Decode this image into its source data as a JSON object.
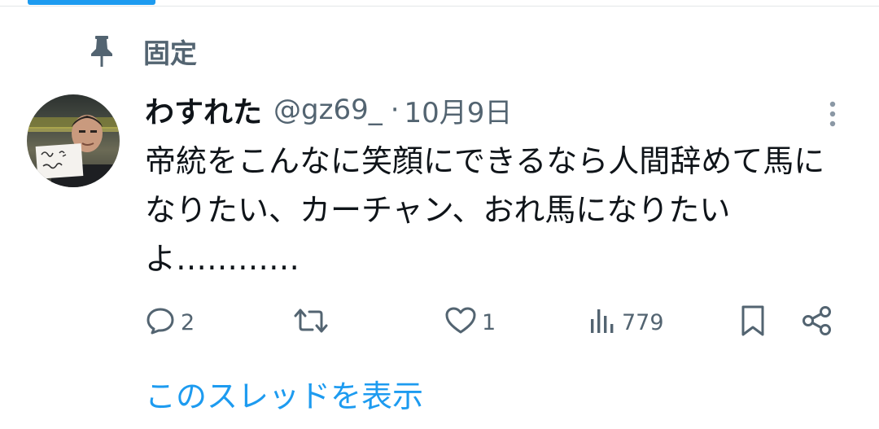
{
  "pinned": {
    "label": "固定"
  },
  "tweet": {
    "display_name": "わすれた",
    "handle": "@gz69_",
    "separator": "·",
    "timestamp": "10月9日",
    "text": "帝統をこんなに笑顔にできるなら人間辞めて馬になりたい、カーチャン、おれ馬になりたいよ…………"
  },
  "actions": {
    "reply_count": "2",
    "retweet_count": "",
    "like_count": "1",
    "view_count": "779"
  },
  "thread_link": "このスレッドを表示",
  "colors": {
    "accent": "#1d9bf0",
    "secondary_text": "#536471",
    "primary_text": "#0f1419"
  },
  "icons": [
    "pin-icon",
    "more-icon",
    "reply-icon",
    "retweet-icon",
    "like-icon",
    "views-icon",
    "bookmark-icon",
    "share-icon"
  ]
}
